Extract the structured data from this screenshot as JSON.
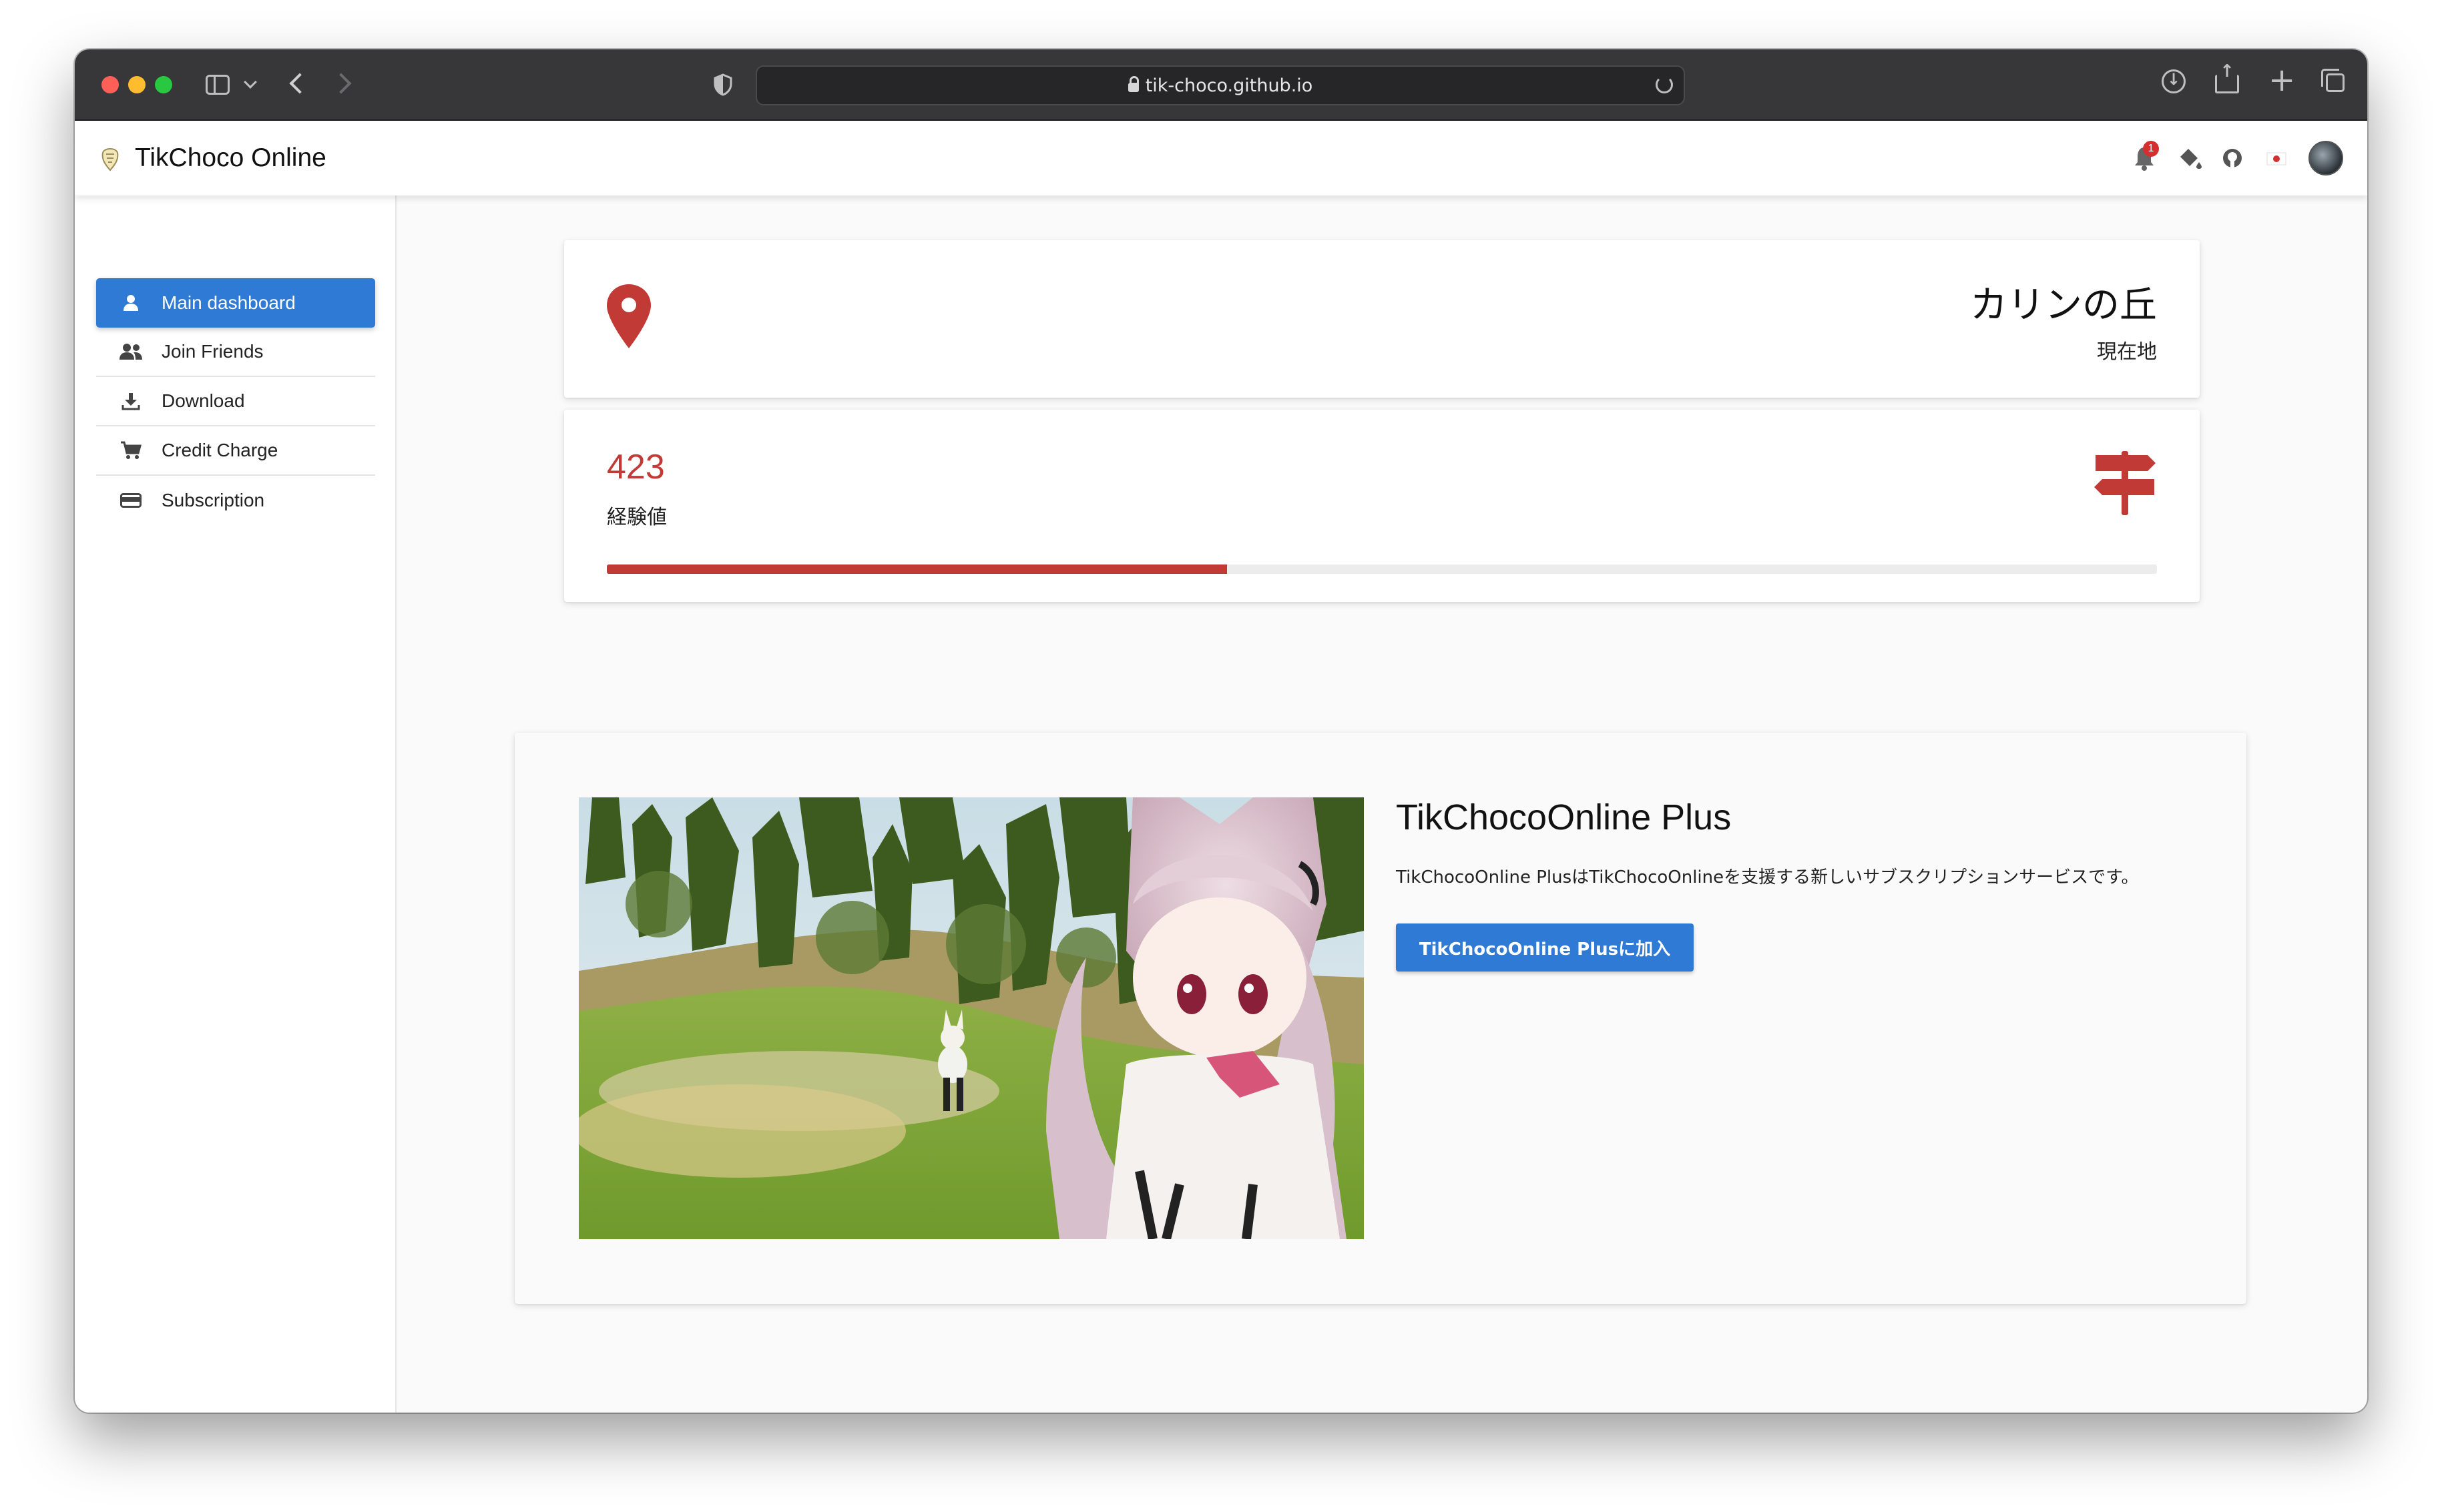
{
  "browser": {
    "url": "tik-choco.github.io"
  },
  "header": {
    "title": "TikChoco Online",
    "notification_count": "1"
  },
  "sidebar": {
    "items": [
      {
        "label": "Main dashboard",
        "icon": "person-icon",
        "active": true
      },
      {
        "label": "Join Friends",
        "icon": "people-icon",
        "active": false
      },
      {
        "label": "Download",
        "icon": "download-icon",
        "active": false
      },
      {
        "label": "Credit Charge",
        "icon": "cart-icon",
        "active": false
      },
      {
        "label": "Subscription",
        "icon": "card-icon",
        "active": false
      }
    ]
  },
  "location_card": {
    "name": "カリンの丘",
    "label": "現在地"
  },
  "exp_card": {
    "value": "423",
    "label": "経験値",
    "progress": 0.4
  },
  "plus_card": {
    "title": "TikChocoOnline Plus",
    "description": "TikChocoOnline PlusはTikChocoOnlineを支援する新しいサブスクリプションサービスです。",
    "button_label": "TikChocoOnline Plusに加入"
  },
  "colors": {
    "accent": "#2f7ad4",
    "danger": "#c23a35",
    "chrome": "#37373a"
  }
}
